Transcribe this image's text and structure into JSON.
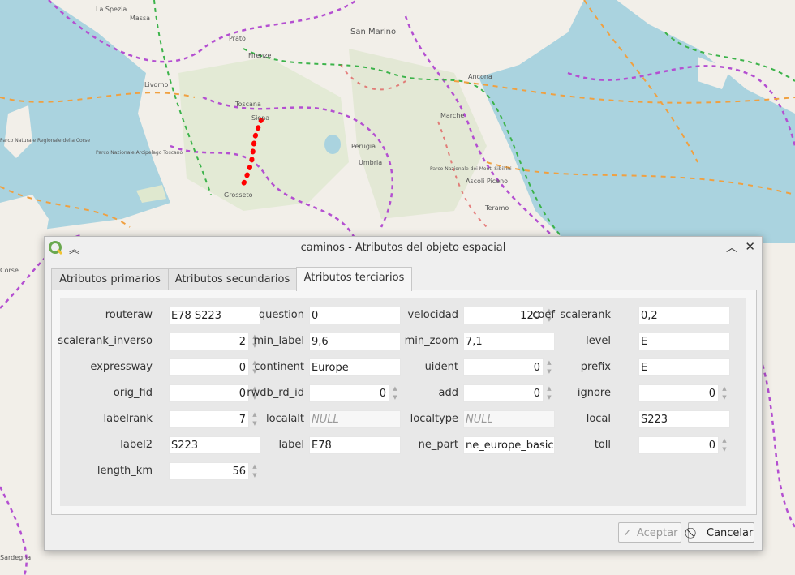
{
  "map": {
    "labels": [
      "La Spezia",
      "Massa",
      "Prato",
      "Firenze",
      "San Marino",
      "Ancona",
      "Livorno",
      "Toscana",
      "Siena",
      "Perugia",
      "Marche",
      "Umbria",
      "Grosseto",
      "Ascoli Piceno",
      "Teramo",
      "Corse",
      "Parco Nazionale dei Monti Sibillini",
      "Parco Nazionale Arcipelago Toscano",
      "Parco Naturale Regionale della Corse",
      "Sardegna"
    ],
    "route_color": "#ff0000"
  },
  "dialog": {
    "title": "caminos - Atributos del objeto espacial",
    "tabs": [
      {
        "label": "Atributos primarios"
      },
      {
        "label": "Atributos secundarios"
      },
      {
        "label": "Atributos terciarios"
      }
    ],
    "active_tab": 2,
    "fields": [
      {
        "label": "routeraw",
        "value": "E78 S223",
        "type": "text"
      },
      {
        "label": "question",
        "value": "0",
        "type": "text"
      },
      {
        "label": "velocidad",
        "value": "120",
        "type": "spin"
      },
      {
        "label": "coef_scalerank",
        "value": "0,2",
        "type": "text"
      },
      {
        "label": "scalerank_inverso",
        "value": "2",
        "type": "spin"
      },
      {
        "label": "min_label",
        "value": "9,6",
        "type": "text"
      },
      {
        "label": "min_zoom",
        "value": "7,1",
        "type": "text"
      },
      {
        "label": "level",
        "value": "E",
        "type": "text"
      },
      {
        "label": "expressway",
        "value": "0",
        "type": "spin"
      },
      {
        "label": "continent",
        "value": "Europe",
        "type": "text"
      },
      {
        "label": "uident",
        "value": "0",
        "type": "spin"
      },
      {
        "label": "prefix",
        "value": "E",
        "type": "text"
      },
      {
        "label": "orig_fid",
        "value": "0",
        "type": "spin"
      },
      {
        "label": "rwdb_rd_id",
        "value": "0",
        "type": "spin"
      },
      {
        "label": "add",
        "value": "0",
        "type": "spin"
      },
      {
        "label": "ignore",
        "value": "0",
        "type": "spin"
      },
      {
        "label": "labelrank",
        "value": "7",
        "type": "spin"
      },
      {
        "label": "localalt",
        "value": "NULL",
        "type": "null"
      },
      {
        "label": "localtype",
        "value": "NULL",
        "type": "null"
      },
      {
        "label": "local",
        "value": "S223",
        "type": "text"
      },
      {
        "label": "label2",
        "value": "S223",
        "type": "text"
      },
      {
        "label": "label",
        "value": "E78",
        "type": "text"
      },
      {
        "label": "ne_part",
        "value": "ne_europe_basic",
        "type": "text"
      },
      {
        "label": "toll",
        "value": "0",
        "type": "spin"
      },
      {
        "label": "length_km",
        "value": "56",
        "type": "spin"
      }
    ],
    "ok_label": "Aceptar",
    "cancel_label": "Cancelar"
  }
}
